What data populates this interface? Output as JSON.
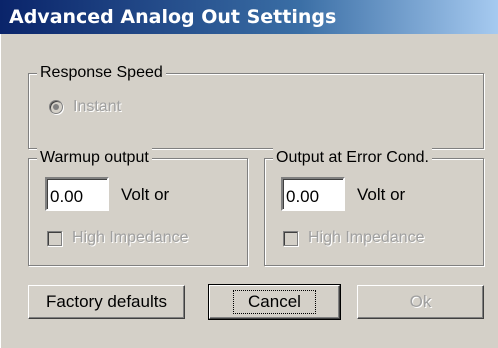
{
  "window": {
    "title": "Advanced Analog Out Settings"
  },
  "response_speed": {
    "title": "Response Speed",
    "option_label": "Instant",
    "selected": true,
    "enabled": false
  },
  "warmup": {
    "title": "Warmup output",
    "value": "0.00",
    "unit_label": "Volt or",
    "high_impedance_label": "High Impedance",
    "high_impedance_checked": false
  },
  "error_cond": {
    "title": "Output at Error Cond.",
    "value": "0.00",
    "unit_label": "Volt or",
    "high_impedance_label": "High Impedance",
    "high_impedance_checked": false
  },
  "buttons": {
    "factory_defaults": "Factory defaults",
    "cancel": "Cancel",
    "ok": "Ok"
  }
}
